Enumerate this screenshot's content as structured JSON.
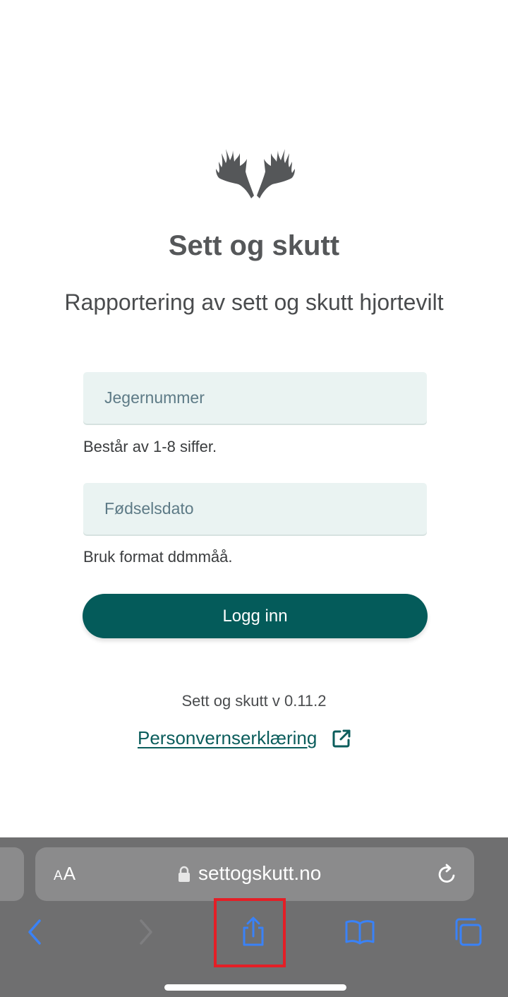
{
  "app": {
    "title": "Sett og skutt",
    "subtitle": "Rapportering av sett og skutt hjortevilt",
    "logo_icon": "moose-antlers-icon"
  },
  "form": {
    "hunter_number": {
      "placeholder": "Jegernummer",
      "value": "",
      "hint": "Består av 1-8 siffer."
    },
    "birth_date": {
      "placeholder": "Fødselsdato",
      "value": "",
      "hint": "Bruk format ddmmåå."
    },
    "login_label": "Logg inn"
  },
  "footer": {
    "version": "Sett og skutt v 0.11.2",
    "privacy_label": "Personvernserklæring",
    "privacy_icon": "external-link-icon"
  },
  "browser": {
    "text_size_label_small": "A",
    "text_size_label_large": "A",
    "url": "settogskutt.no",
    "icons": [
      "back-icon",
      "forward-icon",
      "share-icon",
      "bookmarks-icon",
      "tabs-icon",
      "lock-icon",
      "reload-icon"
    ]
  },
  "colors": {
    "brand": "#045b5a",
    "field_bg": "#eaf3f2",
    "browser_bg": "#6f6f70",
    "browser_accent": "#3a82f7",
    "highlight": "#e41e26"
  }
}
